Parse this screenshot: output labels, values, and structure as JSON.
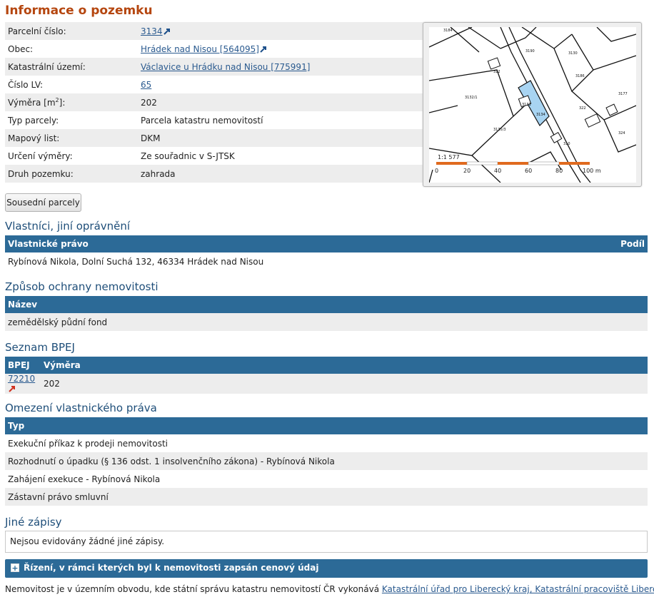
{
  "header": {
    "title": "Informace o pozemku"
  },
  "info": {
    "rows": [
      {
        "label": "Parcelní číslo:",
        "value": "3134",
        "link": true,
        "ext": true
      },
      {
        "label": "Obec:",
        "value": "Hrádek nad Nisou [564095]",
        "link": true,
        "ext": true
      },
      {
        "label": "Katastrální území:",
        "value": "Václavice u Hrádku nad Nisou [775991]",
        "link": true
      },
      {
        "label": "Číslo LV:",
        "value": "65",
        "link": true
      },
      {
        "label": "Výměra [m",
        "label_sup": "2",
        "label_end": "]:",
        "value": "202"
      },
      {
        "label": "Typ parcely:",
        "value": "Parcela katastru nemovitostí"
      },
      {
        "label": "Mapový list:",
        "value": "DKM"
      },
      {
        "label": "Určení výměry:",
        "value": "Ze souřadnic v S-JTSK"
      },
      {
        "label": "Druh pozemku:",
        "value": "zahrada"
      }
    ]
  },
  "map": {
    "scale_label": "1:1 577",
    "scale_ticks": [
      "0",
      "20",
      "40",
      "60",
      "80",
      "100 m"
    ],
    "parcel_labels": [
      "3134",
      "3131",
      "3135/3",
      "3132/1",
      "312",
      "3130/1",
      "3130",
      "3177",
      "3186",
      "3184",
      "3190",
      "322",
      "324",
      "310",
      "3219",
      "3223"
    ]
  },
  "buttons": {
    "neighbors": "Sousední parcely"
  },
  "owners": {
    "title": "Vlastníci, jiní oprávnění",
    "col1": "Vlastnické právo",
    "col2": "Podíl",
    "rows": [
      "Rybínová Nikola, Dolní Suchá 132, 46334 Hrádek nad Nisou"
    ]
  },
  "protection": {
    "title": "Způsob ochrany nemovitosti",
    "col": "Název",
    "rows": [
      "zemědělský půdní fond"
    ]
  },
  "bpej": {
    "title": "Seznam BPEJ",
    "col1": "BPEJ",
    "col2": "Výměra",
    "code": "72210",
    "area": "202"
  },
  "restrictions": {
    "title": "Omezení vlastnického práva",
    "col": "Typ",
    "rows": [
      "Exekuční příkaz k prodeji nemovitosti",
      "Rozhodnutí o úpadku (§ 136 odst. 1 insolvenčního zákona) - Rybínová Nikola",
      "Zahájení exekuce - Rybínová Nikola",
      "Zástavní právo smluvní"
    ]
  },
  "other": {
    "title": "Jiné zápisy",
    "note": "Nejsou evidovány žádné jiné zápisy."
  },
  "proceedings": {
    "label": "Řízení, v rámci kterých byl k nemovitosti zapsán cenový údaj"
  },
  "footer": {
    "text": "Nemovitost je v územním obvodu, kde státní správu katastru nemovitostí ČR vykonává",
    "link": "Katastrální úřad pro Liberecký kraj, Katastrální pracoviště Liberec"
  },
  "colors": {
    "title": "#b5460f",
    "section": "#1e4e79",
    "header_bar": "#2c6a97",
    "parcel_fill": "#a8d4f2",
    "scale_bar": "#e06a1e"
  },
  "icons": {
    "external_link": "external-link-arrow-icon",
    "expand": "plus-box-icon"
  }
}
